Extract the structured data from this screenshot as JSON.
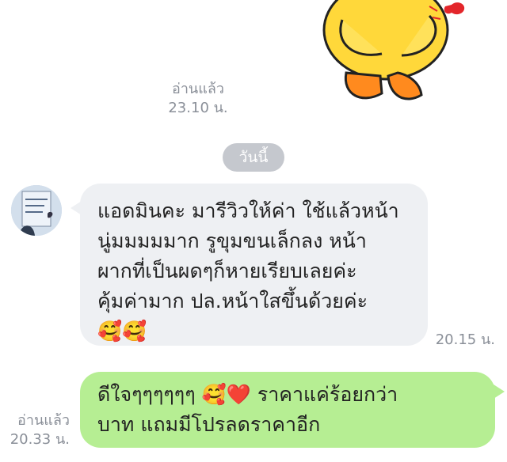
{
  "top": {
    "read_label": "อ่านแล้ว",
    "time": "23.10 น."
  },
  "date_divider": "วันนี้",
  "incoming": {
    "lines": [
      "แอดมินคะ มารีวิวให้ค่า ใช้แล้วหน้า",
      "นู่มมมมมาก รูขุมขนเล็กลง หน้า",
      "ผากที่เป็นผดๆก็หายเรียบเลยค่ะ",
      "คุ้มค่ามาก ปล.หน้าใสขึ้นด้วยค่ะ"
    ],
    "emojis": "🥰🥰",
    "time": "20.15 น."
  },
  "outgoing": {
    "line1_text": "ดีใจๆๆๆๆๆๆ ",
    "line1_emojis": "🥰❤️",
    "line1_rest": "  ราคาแค่ร้อยกว่า",
    "line2": "บาท แถมมีโปรลดราคาอีก",
    "read_label": "อ่านแล้ว",
    "time": "20.33 น."
  },
  "colors": {
    "incoming_bubble": "#eef0f3",
    "outgoing_bubble": "#b6ee93",
    "meta_text": "#8a8f98",
    "date_pill": "#c5c8ce"
  },
  "icons": {
    "sticker": "yellow-duck-sticker",
    "avatar": "user-avatar"
  }
}
